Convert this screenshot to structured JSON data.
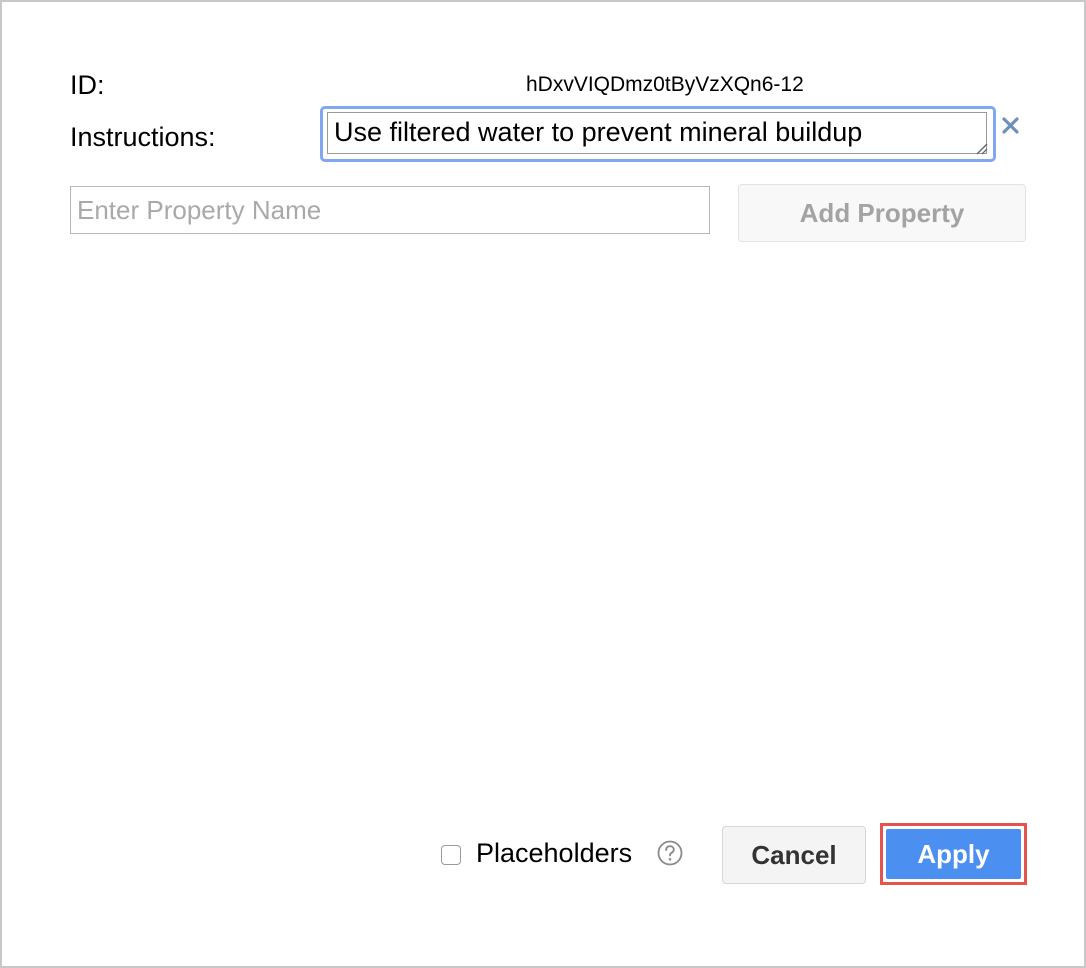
{
  "dialog": {
    "id_label": "ID:",
    "id_value": "hDxvVIQDmz0tByVzXQn6-12",
    "instructions_label": "Instructions:",
    "instructions_value": "Use filtered water to prevent mineral buildup",
    "property_name_placeholder": "Enter Property Name",
    "add_property_label": "Add Property",
    "placeholders_label": "Placeholders",
    "placeholders_checked": false,
    "cancel_label": "Cancel",
    "apply_label": "Apply"
  },
  "icons": {
    "remove": "close-icon",
    "help": "help-icon",
    "resize": "resize-grip-icon"
  },
  "colors": {
    "accent": "#4b8ff1",
    "focus_ring": "#7fa7f2",
    "highlight": "#e6524c",
    "remove_icon": "#6f8fbf"
  }
}
